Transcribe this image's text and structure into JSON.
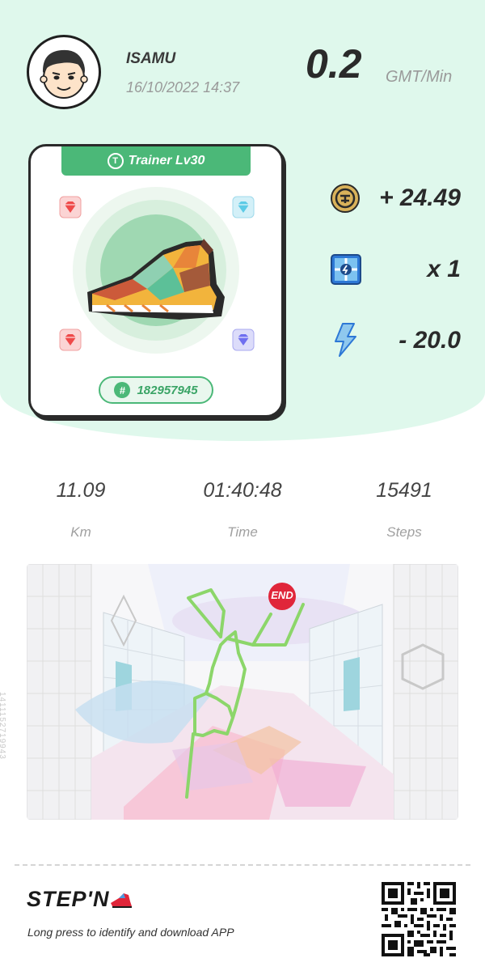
{
  "user": {
    "name": "ISAMU",
    "date": "16/10/2022 14:37"
  },
  "earning_rate": {
    "value": "0.2",
    "unit": "GMT/Min"
  },
  "sneaker": {
    "type_label": "Trainer Lv30",
    "type_icon": "T",
    "id_prefix": "#",
    "id": "182957945",
    "gem_slots": [
      "red-gem-icon",
      "blue-gem-icon",
      "red-gem-icon",
      "purple-gem-icon"
    ]
  },
  "rewards": [
    {
      "icon": "gmt-coin-icon",
      "value": "+ 24.49"
    },
    {
      "icon": "mystery-box-icon",
      "value": "x 1"
    },
    {
      "icon": "energy-icon",
      "value": "- 20.0"
    }
  ],
  "stats": [
    {
      "value": "11.09",
      "label": "Km"
    },
    {
      "value": "01:40:48",
      "label": "Time"
    },
    {
      "value": "15491",
      "label": "Steps"
    }
  ],
  "map": {
    "end_label": "END",
    "code": "1411152719943"
  },
  "footer": {
    "logo": "STEP'N",
    "download_text": "Long press to identify and download APP"
  },
  "colors": {
    "accent": "#4bb878",
    "background": "#dff8ec",
    "route": "#8cd66a",
    "end_marker": "#e0263a"
  }
}
